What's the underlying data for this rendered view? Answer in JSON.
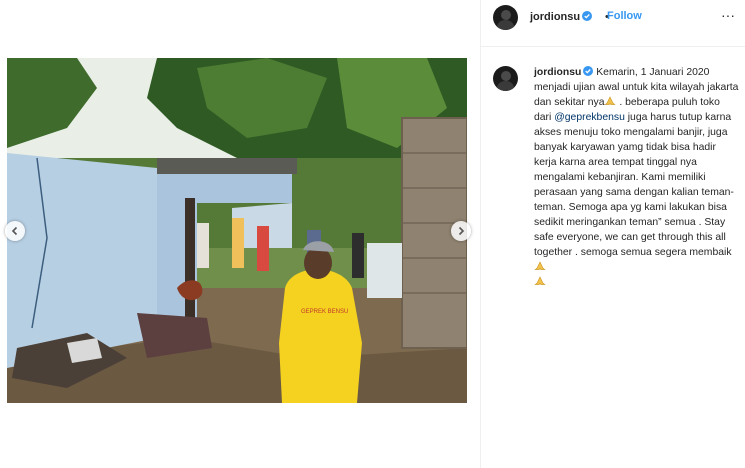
{
  "post": {
    "username": "jordionsu",
    "follow_label": "Follow",
    "separator": "•",
    "more_label": "···"
  },
  "caption": {
    "author": "jordionsu",
    "part1": "Kemarin, 1 Januari 2020 menjadi ujian awal untuk kita wilayah jakarta dan sekitar nya",
    "part2": " . beberapa puluh toko dari ",
    "mention": "@geprekbensu",
    "part3": " juga harus tutup karna akses menuju toko mengalami banjir, juga banyak karyawan yamg tidak bisa hadir kerja karna area tempat tinggal nya mengalami kebanjiran. Kami memiliki perasaan yang sama dengan kalian teman-teman. Semoga apa yg kami lakukan bisa sedikit meringankan teman” semua . Stay safe everyone, we can get through this all together . semoga semua segera membaik"
  },
  "photo": {
    "shirt_text": "GEPREK BENSU"
  },
  "colors": {
    "link": "#3897f0",
    "verified": "#3897f0",
    "shirt": "#f5d21f"
  }
}
